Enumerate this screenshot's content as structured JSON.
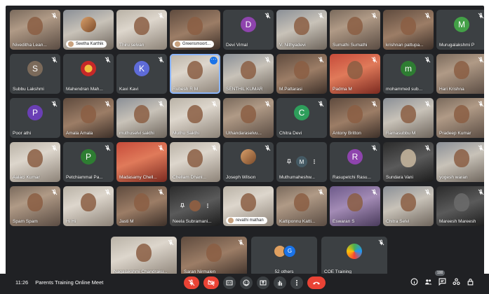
{
  "meeting": {
    "time": "11:26",
    "title": "Parents Training Online Meet",
    "participant_count": "100"
  },
  "colors": {
    "stage_bg": "#202124",
    "tile_bg": "#3c4043",
    "accent_blue": "#1a73e8",
    "danger_red": "#ea4335"
  },
  "tiles": [
    {
      "name": "Niveditha Lean..."
    },
    {
      "name": "Seetha Karthik"
    },
    {
      "name": "Thiru selvan"
    },
    {
      "name": "Greensmoort..."
    },
    {
      "name": "Devi Vimal",
      "initial": "D",
      "avatar_color": "#8e44ad"
    },
    {
      "name": "V. Nithyadevi"
    },
    {
      "name": "Sumathi Sumathi"
    },
    {
      "name": "krishnan pattupa..."
    },
    {
      "name": "Murugalakshmi P",
      "initial": "M",
      "avatar_color": "#43a047"
    },
    {
      "name": "Subbu Lakshmi",
      "initial": "S",
      "avatar_color": "#7b6a5a"
    },
    {
      "name": "Mahendran Mah..."
    },
    {
      "name": "Kavi Kavi",
      "initial": "K",
      "avatar_color": "#5e6bd8"
    },
    {
      "name": "Rubesh R M"
    },
    {
      "name": "SENTHIL KUMAR"
    },
    {
      "name": "M.Pattarasi"
    },
    {
      "name": "Padma M"
    },
    {
      "name": "mohammed sub...",
      "initial": "m",
      "avatar_color": "#2e7d32"
    },
    {
      "name": "Hari Krishna"
    },
    {
      "name": "Poor athi",
      "initial": "P",
      "avatar_color": "#6a3fb5"
    },
    {
      "name": "Amala Amala"
    },
    {
      "name": "muthuselvi sakthi"
    },
    {
      "name": "Muthu Sakthi"
    },
    {
      "name": "Uthandaraselvu..."
    },
    {
      "name": "Chitra Devi",
      "initial": "C",
      "avatar_color": "#2e9e5b"
    },
    {
      "name": "Antony Britton"
    },
    {
      "name": "Ramasubbu M"
    },
    {
      "name": "Pradeep Kumar"
    },
    {
      "name": "Aalaci Kumar"
    },
    {
      "name": "Petchiammal Pa...",
      "initial": "P",
      "avatar_color": "#2e7d32"
    },
    {
      "name": "Madasamy Chell..."
    },
    {
      "name": "Chellam Dhanl..."
    },
    {
      "name": "Joseph Wilson"
    },
    {
      "name": "Muthumaheshw...",
      "initial": "M",
      "avatar_color": "#455a64"
    },
    {
      "name": "Rasupetchi Rasu...",
      "initial": "R",
      "avatar_color": "#8e44ad"
    },
    {
      "name": "Sundara Vani"
    },
    {
      "name": "yogesh waran"
    },
    {
      "name": "Spam Spam"
    },
    {
      "name": "Hi Hi"
    },
    {
      "name": "Jasti M"
    },
    {
      "name": "Neela Subramani..."
    },
    {
      "name": "revathi mathan"
    },
    {
      "name": "Kattiponnu Katti..."
    },
    {
      "name": "Eswaran S"
    },
    {
      "name": "Chitra Selvi"
    },
    {
      "name": "Mareesh Mareesh"
    }
  ],
  "bottom_tiles": [
    {
      "name": "Nagalakshmi Chandraku..."
    },
    {
      "name": "Saran Nirmalen"
    },
    {
      "name": "52 others",
      "avatar_letter": "G"
    },
    {
      "name": "COE Training"
    }
  ]
}
